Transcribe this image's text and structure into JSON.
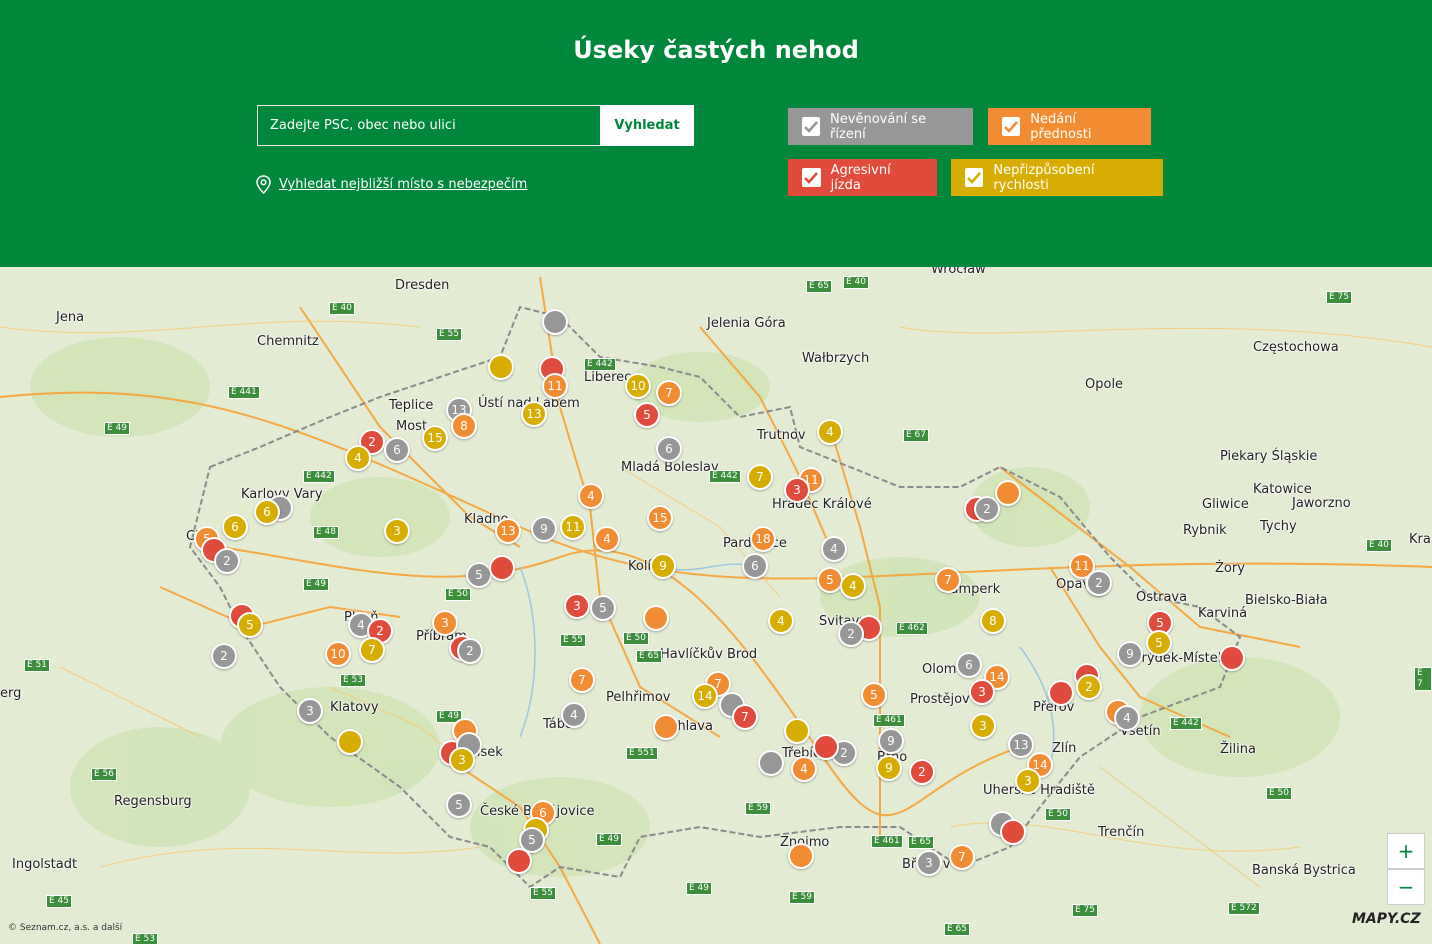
{
  "header": {
    "title": "Úseky častých nehod",
    "search_placeholder": "Zadejte PSČ, obec nebo ulici",
    "search_button": "Vyhledat",
    "nearest_link": "Vyhledat nejbližší místo s nebezpečím"
  },
  "filters": [
    {
      "label": "Nevěnování se řízení",
      "color": "#979797",
      "checked": true
    },
    {
      "label": "Nedání přednosti",
      "color": "#f28c32",
      "checked": true
    },
    {
      "label": "Agresivní jízda",
      "color": "#e04b3c",
      "checked": true
    },
    {
      "label": "Nepřizpůsobení rychlosti",
      "color": "#d6ad00",
      "checked": true
    }
  ],
  "colors": {
    "gray": "#979797",
    "orange": "#f28c32",
    "red": "#e04b3c",
    "yellow": "#d6ad00",
    "brand": "#00873c"
  },
  "map": {
    "labels": [
      "Wrocław",
      "Dresden",
      "Jena",
      "Chemnitz",
      "Jelenia Góra",
      "Wałbrzych",
      "Częstochowa",
      "Opole",
      "Teplice",
      "Ústí nad Labem",
      "Most",
      "Liberec",
      "Trutnov",
      "Mladá Boleslav",
      "Hradec Králové",
      "Karlovy Vary",
      "Kladno",
      "Pardubice",
      "Kolín",
      "Piekary Śląskie",
      "Katowice",
      "Gliwice",
      "Jaworzno",
      "Rybnik",
      "Tychy",
      "Żory",
      "Ostrava",
      "Bielsko-Biała",
      "Karviná",
      "Opava",
      "Šumperk",
      "Svitavy",
      "Frýdek-Místek",
      "Olomouc",
      "Prostějov",
      "Přerov",
      "Vsetín",
      "Plzeň",
      "Příbram",
      "Havlíčkův Brod",
      "Pelhřimov",
      "Jihlava",
      "Tábor",
      "Písek",
      "Klatovy",
      "Zlín",
      "Brno",
      "Třebíč",
      "Uherské Hradiště",
      "Žilina",
      "Regensburg",
      "České Budějovice",
      "Znojmo",
      "Trenčín",
      "Ingolstadt",
      "Břeclav",
      "Banská Bystrica",
      "Kra",
      "erg",
      "Cheb"
    ],
    "roads": [
      "E 65",
      "E 40",
      "E 75",
      "E 40",
      "E 55",
      "E 442",
      "E 441",
      "E 49",
      "E 442",
      "E 48",
      "E 49",
      "E 50",
      "E 55",
      "E 50",
      "E 65",
      "E 53",
      "E 51",
      "E 49",
      "E 56",
      "E 49",
      "E 551",
      "E 59",
      "E 442",
      "E 67",
      "E 462",
      "E 461",
      "E 442",
      "E 50",
      "E 40",
      "E 461",
      "E 65",
      "E 59",
      "E 49",
      "E 55",
      "E 45",
      "E 53",
      "E 572",
      "E 75",
      "E 65",
      "E 50",
      "E 7"
    ],
    "markers": [
      {
        "c": "gray",
        "n": ""
      },
      {
        "c": "yellow",
        "n": ""
      },
      {
        "c": "red",
        "n": ""
      },
      {
        "c": "orange",
        "n": "11"
      },
      {
        "c": "yellow",
        "n": "10"
      },
      {
        "c": "orange",
        "n": "7"
      },
      {
        "c": "red",
        "n": "5"
      },
      {
        "c": "yellow",
        "n": "13"
      },
      {
        "c": "gray",
        "n": "13"
      },
      {
        "c": "orange",
        "n": "8"
      },
      {
        "c": "yellow",
        "n": "15"
      },
      {
        "c": "red",
        "n": "2"
      },
      {
        "c": "gray",
        "n": "6"
      },
      {
        "c": "yellow",
        "n": "4"
      },
      {
        "c": "gray",
        "n": "6"
      },
      {
        "c": "yellow",
        "n": "4"
      },
      {
        "c": "yellow",
        "n": "7"
      },
      {
        "c": "orange",
        "n": "11"
      },
      {
        "c": "red",
        "n": "3"
      },
      {
        "c": "orange",
        "n": "4"
      },
      {
        "c": "gray",
        "n": ""
      },
      {
        "c": "yellow",
        "n": "6"
      },
      {
        "c": "yellow",
        "n": "6"
      },
      {
        "c": "orange",
        "n": "5"
      },
      {
        "c": "red",
        "n": ""
      },
      {
        "c": "gray",
        "n": "2"
      },
      {
        "c": "yellow",
        "n": "3"
      },
      {
        "c": "orange",
        "n": "13"
      },
      {
        "c": "gray",
        "n": "9"
      },
      {
        "c": "yellow",
        "n": "11"
      },
      {
        "c": "orange",
        "n": "15"
      },
      {
        "c": "orange",
        "n": "4"
      },
      {
        "c": "orange",
        "n": "18"
      },
      {
        "c": "gray",
        "n": "6"
      },
      {
        "c": "gray",
        "n": "4"
      },
      {
        "c": "orange",
        "n": "5"
      },
      {
        "c": "yellow",
        "n": "4"
      },
      {
        "c": "yellow",
        "n": "9"
      },
      {
        "c": "gray",
        "n": "5"
      },
      {
        "c": "red",
        "n": ""
      },
      {
        "c": "red",
        "n": "3"
      },
      {
        "c": "gray",
        "n": "5"
      },
      {
        "c": "orange",
        "n": ""
      },
      {
        "c": "orange",
        "n": "3"
      },
      {
        "c": "red",
        "n": ""
      },
      {
        "c": "gray",
        "n": "2"
      },
      {
        "c": "red",
        "n": ""
      },
      {
        "c": "yellow",
        "n": "5"
      },
      {
        "c": "gray",
        "n": "4"
      },
      {
        "c": "red",
        "n": "2"
      },
      {
        "c": "yellow",
        "n": "7"
      },
      {
        "c": "orange",
        "n": "10"
      },
      {
        "c": "gray",
        "n": "2"
      },
      {
        "c": "yellow",
        "n": "4"
      },
      {
        "c": "red",
        "n": ""
      },
      {
        "c": "gray",
        "n": "2"
      },
      {
        "c": "red",
        "n": ""
      },
      {
        "c": "gray",
        "n": "2"
      },
      {
        "c": "orange",
        "n": ""
      },
      {
        "c": "orange",
        "n": "7"
      },
      {
        "c": "yellow",
        "n": "8"
      },
      {
        "c": "orange",
        "n": "11"
      },
      {
        "c": "gray",
        "n": "2"
      },
      {
        "c": "red",
        "n": "5"
      },
      {
        "c": "yellow",
        "n": "5"
      },
      {
        "c": "gray",
        "n": "9"
      },
      {
        "c": "red",
        "n": ""
      },
      {
        "c": "gray",
        "n": "6"
      },
      {
        "c": "orange",
        "n": "14"
      },
      {
        "c": "red",
        "n": "3"
      },
      {
        "c": "orange",
        "n": "5"
      },
      {
        "c": "orange",
        "n": "7"
      },
      {
        "c": "yellow",
        "n": "14"
      },
      {
        "c": "gray",
        "n": ""
      },
      {
        "c": "red",
        "n": "7"
      },
      {
        "c": "yellow",
        "n": ""
      },
      {
        "c": "orange",
        "n": ""
      },
      {
        "c": "gray",
        "n": "4"
      },
      {
        "c": "orange",
        "n": "7"
      },
      {
        "c": "gray",
        "n": "3"
      },
      {
        "c": "yellow",
        "n": ""
      },
      {
        "c": "orange",
        "n": ""
      },
      {
        "c": "red",
        "n": ""
      },
      {
        "c": "gray",
        "n": ""
      },
      {
        "c": "yellow",
        "n": "3"
      },
      {
        "c": "gray",
        "n": "9"
      },
      {
        "c": "yellow",
        "n": "9"
      },
      {
        "c": "red",
        "n": "2"
      },
      {
        "c": "gray",
        "n": "2"
      },
      {
        "c": "red",
        "n": ""
      },
      {
        "c": "orange",
        "n": "4"
      },
      {
        "c": "gray",
        "n": ""
      },
      {
        "c": "yellow",
        "n": "3"
      },
      {
        "c": "gray",
        "n": "13"
      },
      {
        "c": "orange",
        "n": "14"
      },
      {
        "c": "yellow",
        "n": "3"
      },
      {
        "c": "red",
        "n": ""
      },
      {
        "c": "yellow",
        "n": "2"
      },
      {
        "c": "orange",
        "n": ""
      },
      {
        "c": "gray",
        "n": "4"
      },
      {
        "c": "gray",
        "n": "5"
      },
      {
        "c": "orange",
        "n": "6"
      },
      {
        "c": "yellow",
        "n": ""
      },
      {
        "c": "gray",
        "n": "5"
      },
      {
        "c": "red",
        "n": ""
      },
      {
        "c": "gray",
        "n": ""
      },
      {
        "c": "red",
        "n": ""
      },
      {
        "c": "orange",
        "n": ""
      },
      {
        "c": "gray",
        "n": "3"
      },
      {
        "c": "orange",
        "n": "7"
      },
      {
        "c": "red",
        "n": ""
      },
      {
        "c": "gray",
        "n": "2"
      }
    ],
    "zoom_in": "+",
    "zoom_out": "−",
    "copyright": "© Seznam.cz, a.s. a další",
    "logo": "MAPY.CZ"
  }
}
